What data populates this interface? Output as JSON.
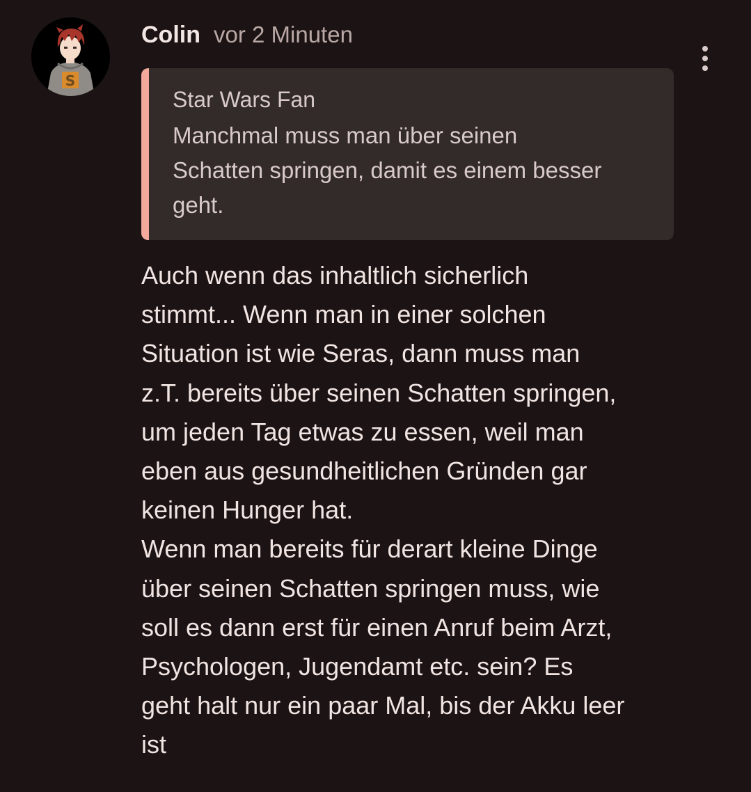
{
  "comment": {
    "author": "Colin",
    "timestamp": "vor 2 Minuten",
    "avatar_icon": "avatar-icon",
    "more_icon": "more-vert-icon",
    "quote": {
      "author": "Star Wars Fan",
      "text": "Manchmal muss man über seinen\nSchatten springen, damit es einem besser\ngeht."
    },
    "body": "Auch wenn das inhaltlich sicherlich\nstimmt... Wenn man in einer solchen\nSituation ist wie Seras, dann muss man\nz.T. bereits über seinen Schatten springen,\num jeden Tag etwas zu essen, weil man\neben aus gesundheitlichen Gründen gar\nkeinen Hunger hat.\nWenn man bereits für derart kleine Dinge\nüber seinen Schatten springen muss, wie\nsoll es dann erst für einen Anruf beim Arzt,\nPsychologen, Jugendamt etc. sein? Es\ngeht halt nur ein paar Mal, bis der Akku leer\nist"
  },
  "colors": {
    "background": "#1c1414",
    "quote_background": "#322b2a",
    "quote_accent": "#f2a99c",
    "text": "#f1e5e3",
    "muted_text": "#b9a8a5"
  }
}
